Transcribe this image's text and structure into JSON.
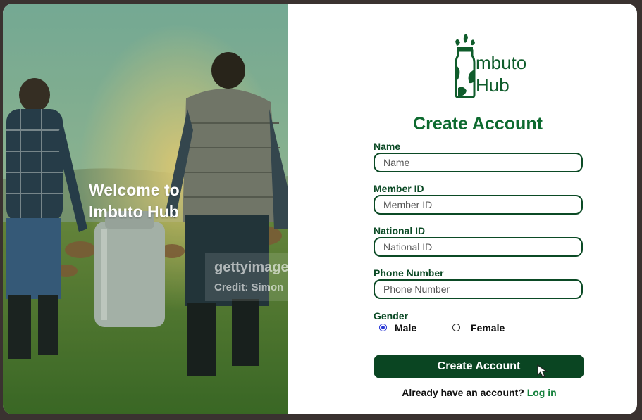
{
  "hero": {
    "welcome_line1": "Welcome to",
    "welcome_line2": "Imbuto Hub",
    "watermark_brand": "gettyimage",
    "watermark_credit": "Credit: Simon"
  },
  "brand": {
    "logo_line1": "mbuto",
    "logo_line2": "Hub"
  },
  "form": {
    "title": "Create Account",
    "fields": [
      {
        "label": "Name",
        "placeholder": "Name"
      },
      {
        "label": "Member ID",
        "placeholder": "Member ID"
      },
      {
        "label": "National ID",
        "placeholder": "National ID"
      },
      {
        "label": "Phone Number",
        "placeholder": "Phone Number"
      }
    ],
    "gender": {
      "label": "Gender",
      "options": [
        "Male",
        "Female"
      ],
      "selected": "Male"
    },
    "submit_label": "Create Account",
    "footer_text": "Already have an account?",
    "footer_link": "Log in"
  },
  "colors": {
    "brand_green": "#0d6a2f",
    "button_green": "#0a4522",
    "link_green": "#16823d",
    "radio_accent": "#2a39d6"
  },
  "icons": [
    "milk-bottle-logo-icon",
    "mouse-pointer-icon"
  ]
}
